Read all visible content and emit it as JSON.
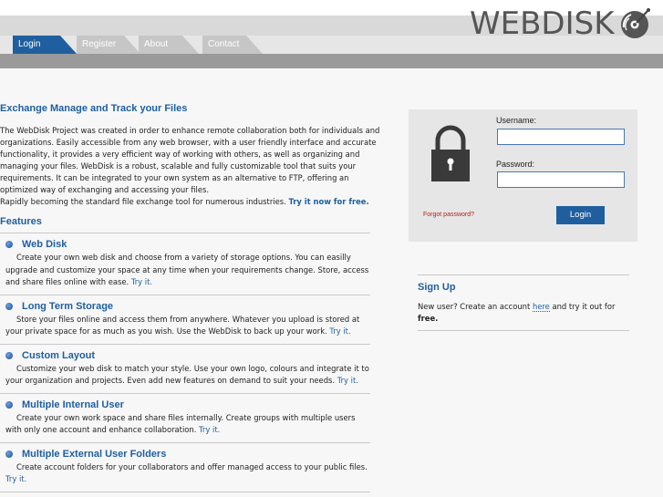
{
  "header": {
    "logo_text": "WEBDISK",
    "tabs": [
      {
        "label": "Login"
      },
      {
        "label": "Register"
      },
      {
        "label": "About"
      },
      {
        "label": "Contact"
      }
    ]
  },
  "intro": {
    "title": "Exchange Manage and Track your Files",
    "paragraph": "The WebDisk Project was created in order to enhance remote collaboration both for individuals and organizations. Easily accessible from any web browser, with a user friendly interface and accurate functionality, it provides a very efficient way of working with others, as well as organizing and managing your files. WebDisk is a robust, scalable and fully customizable tool that suits your requirements. It can be integrated to your own system as an alternative to FTP, offering an optimized way of exchanging and accessing your files.",
    "paragraph2": "Rapidly becoming the standard file exchange tool for numerous industries.",
    "try_link": "Try it now for free."
  },
  "features": {
    "heading": "Features",
    "items": [
      {
        "name": "Web Disk",
        "desc": "Create your own web disk and choose from a variety of storage options. You can easilly upgrade and customize your space at any time when your requirements change. Store, access and share files online with ease.",
        "link": "Try it."
      },
      {
        "name": "Long Term Storage",
        "desc": "Store your files online and access them from anywhere. Whatever you upload is stored at your private space for as much as you wish. Use the WebDisk to back up your work.",
        "link": "Try it."
      },
      {
        "name": "Custom Layout",
        "desc": "Customize your web disk to match your style. Use your own logo, colours and integrate it to your organization and projects. Even add new features on demand to suit your needs.",
        "link": "Try it."
      },
      {
        "name": "Multiple Internal User",
        "desc": "Create your own work space and share files internally. Create groups with multiple users with only one account and enhance collaboration.",
        "link": "Try it."
      },
      {
        "name": "Multiple External User Folders",
        "desc": "Create account folders for your collaborators and offer managed access to your public files.",
        "link": "Try it."
      }
    ]
  },
  "login": {
    "username_label": "Username:",
    "username_value": "",
    "password_label": "Password:",
    "password_value": "",
    "forgot_label": "Forgot password?",
    "button_label": "Login"
  },
  "signup": {
    "heading": "Sign Up",
    "text_before": "New user? Create an account ",
    "here_link": "here",
    "text_after": " and try it out for ",
    "free": "free."
  },
  "colors": {
    "accent": "#1f5fa0",
    "forgot": "#b81e1e",
    "header_bar": "#9a9a9a"
  }
}
